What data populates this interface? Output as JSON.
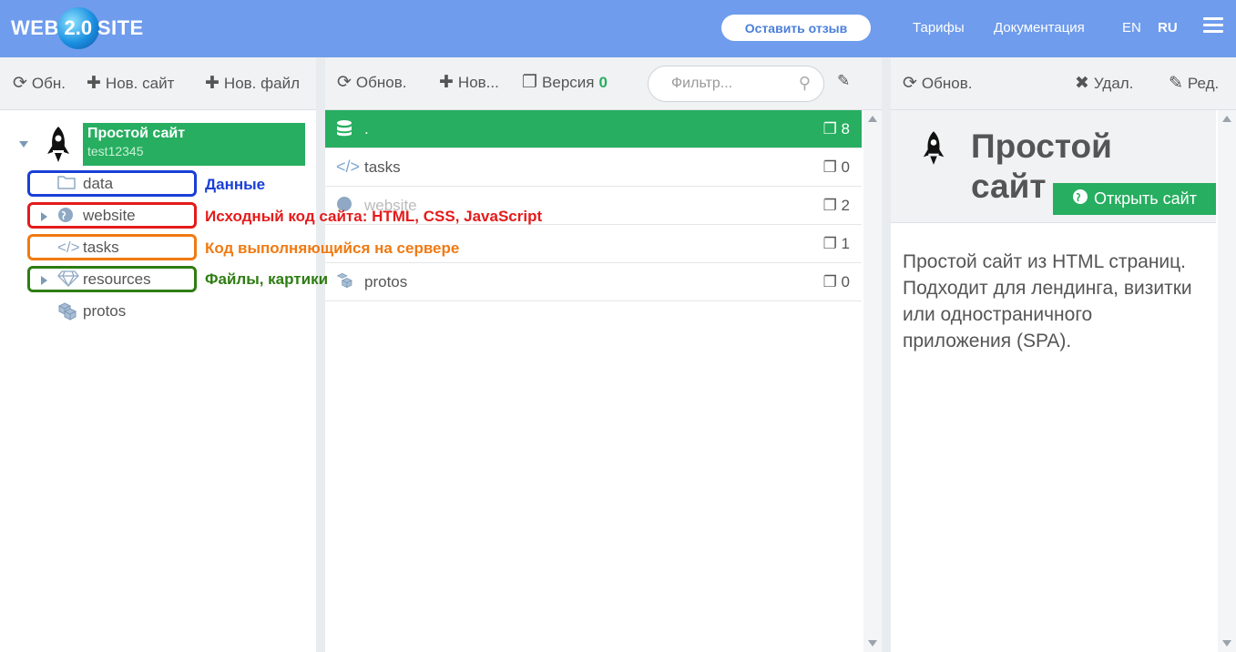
{
  "header": {
    "logo_left": "WEB",
    "logo_mid": "2.0",
    "logo_right": "SITE",
    "feedback_label": "Оставить отзыв",
    "nav": [
      "Тарифы",
      "Документация"
    ],
    "lang_en": "EN",
    "lang_ru": "RU",
    "bg_color": "#6f9cec"
  },
  "left_panel": {
    "toolbar": {
      "refresh": "Обн.",
      "new_site": "Нов. сайт",
      "new_file": "Нов. файл"
    },
    "root": {
      "title": "Простой сайт",
      "subtitle": "test12345"
    },
    "items": [
      {
        "label": "data",
        "icon": "folder-icon",
        "expandable": false
      },
      {
        "label": "website",
        "icon": "globe-icon",
        "expandable": true
      },
      {
        "label": "tasks",
        "icon": "code-icon",
        "expandable": false
      },
      {
        "label": "resources",
        "icon": "diamond-icon",
        "expandable": true
      },
      {
        "label": "protos",
        "icon": "cubes-icon",
        "expandable": false
      }
    ],
    "annotations": [
      {
        "text": "Данные",
        "color": "#1a3fd6"
      },
      {
        "text": "Исходный код сайта: HTML, CSS, JavaScript",
        "color": "#e41b1b"
      },
      {
        "text": "Код выполняющийся на сервере",
        "color": "#f07a12"
      },
      {
        "text": "Файлы, картики",
        "color": "#2e7d12"
      }
    ]
  },
  "middle_panel": {
    "toolbar": {
      "refresh": "Обнов.",
      "new": "Нов...",
      "version_label": "Версия",
      "version_value": "0",
      "filter_placeholder": "Фильтр..."
    },
    "rows": [
      {
        "name": ".",
        "icon": "database-icon",
        "count": "8",
        "active": true
      },
      {
        "name": "tasks",
        "icon": "code-icon",
        "count": "0",
        "active": false
      },
      {
        "name": "website",
        "icon": "globe-icon",
        "count": "2",
        "active": false
      },
      {
        "name": "",
        "icon": "diamond-icon",
        "count": "1",
        "active": false
      },
      {
        "name": "protos",
        "icon": "cubes-icon",
        "count": "0",
        "active": false
      }
    ]
  },
  "right_panel": {
    "toolbar": {
      "refresh": "Обнов.",
      "delete": "Удал.",
      "edit": "Ред."
    },
    "title": "Простой сайт",
    "open_site_label": "Открыть сайт",
    "description": "Простой сайт из HTML страниц. Подходит для лендинга, визитки или одностраничного приложения (SPA).",
    "accent_color": "#27ae60"
  }
}
